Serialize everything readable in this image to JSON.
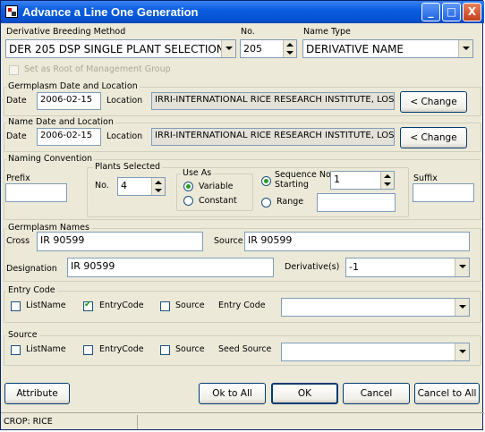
{
  "window": {
    "title": "Advance a Line One Generation",
    "minimize": "_",
    "maximize": "□",
    "close": "X"
  },
  "top": {
    "method_label": "Derivative Breeding Method",
    "method_value": "DER  205 DSP SINGLE PLANT SELECTION",
    "no_label": "No.",
    "no_value": "205",
    "nametype_label": "Name Type",
    "nametype_value": "DERIVATIVE NAME",
    "root_checkbox_label": "Set as Root of Management Group"
  },
  "germplasm_date": {
    "title": "Germplasm Date and Location",
    "date_label": "Date",
    "date_value": "2006-02-15",
    "location_label": "Location",
    "location_value": "IRRI-INTERNATIONAL RICE RESEARCH INSTITUTE, LOS BAÑOS",
    "change_label": "< Change"
  },
  "name_date": {
    "title": "Name Date and Location",
    "date_label": "Date",
    "date_value": "2006-02-15",
    "location_label": "Location",
    "location_value": "IRRI-INTERNATIONAL RICE RESEARCH INSTITUTE, LOS BAÑOS",
    "change_label": "< Change"
  },
  "naming": {
    "title": "Naming Convention",
    "prefix_label": "Prefix",
    "prefix_value": "",
    "plants_title": "Plants Selected",
    "plants_no_label": "No.",
    "plants_no_value": "4",
    "useas_title": "Use As",
    "variable_label": "Variable",
    "constant_label": "Constant",
    "seq_label_1": "Sequence No",
    "seq_label_2": "Starting",
    "seq_value": "1",
    "range_label": "Range",
    "range_value": "",
    "suffix_label": "Suffix",
    "suffix_value": ""
  },
  "names": {
    "title": "Germplasm Names",
    "cross_label": "Cross",
    "cross_value": "IR 90599",
    "source_label": "Source",
    "source_value": "IR 90599",
    "designation_label": "Designation",
    "designation_value": "IR 90599",
    "derivative_label": "Derivative(s)",
    "derivative_value": "-1"
  },
  "entry_code": {
    "title": "Entry Code",
    "listname_label": "ListName",
    "entrycode_label": "EntryCode",
    "source_label": "Source",
    "field_label": "Entry Code",
    "field_value": ""
  },
  "source_group": {
    "title": "Source",
    "listname_label": "ListName",
    "entrycode_label": "EntryCode",
    "source_label": "Source",
    "field_label": "Seed Source",
    "field_value": ""
  },
  "buttons": {
    "attribute": "Attribute",
    "ok_to_all": "Ok to All",
    "ok": "OK",
    "cancel": "Cancel",
    "cancel_to_all": "Cancel to All"
  },
  "status": {
    "crop": "CROP: RICE"
  }
}
